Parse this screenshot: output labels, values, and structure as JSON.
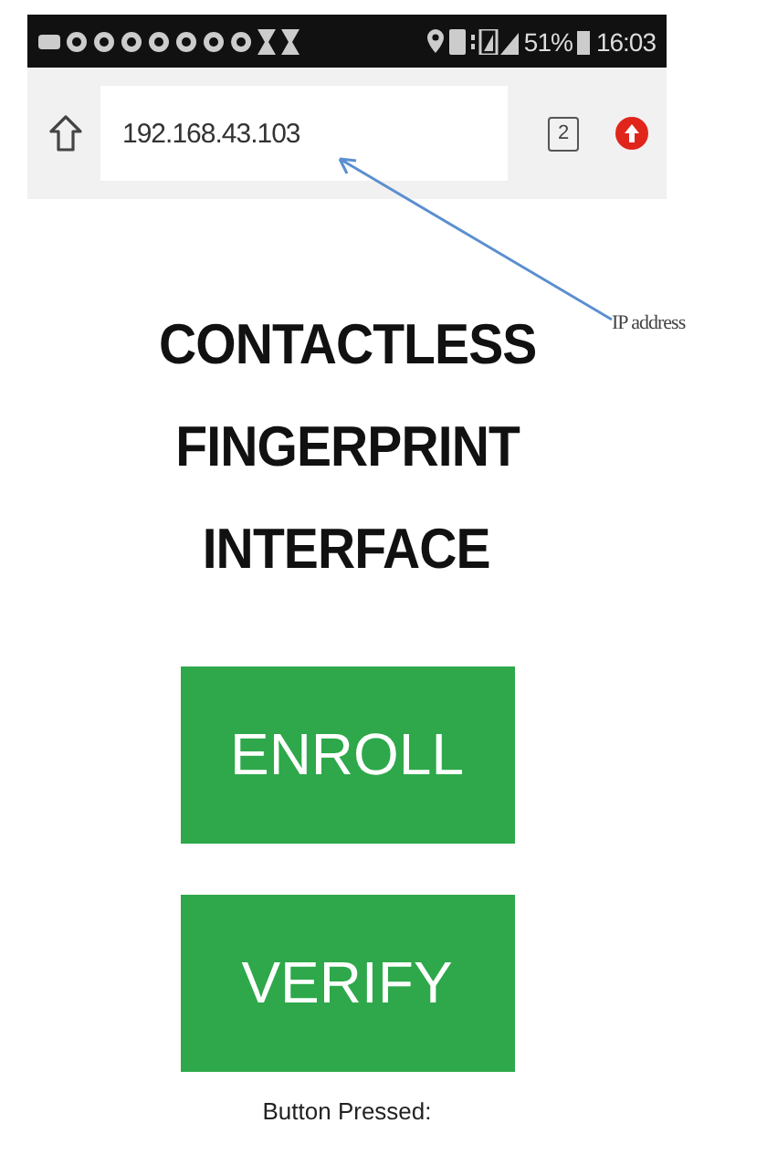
{
  "status_bar": {
    "battery": "51%",
    "time": "16:03"
  },
  "browser": {
    "url": "192.168.43.103",
    "tab_count": "2"
  },
  "page": {
    "title_lines": [
      "CONTACTLESS",
      "FINGERPRINT",
      "INTERFACE"
    ],
    "buttons": [
      "ENROLL",
      "VERIFY"
    ],
    "status_text": "Button Pressed:"
  },
  "annotation": {
    "label": "IP address"
  }
}
